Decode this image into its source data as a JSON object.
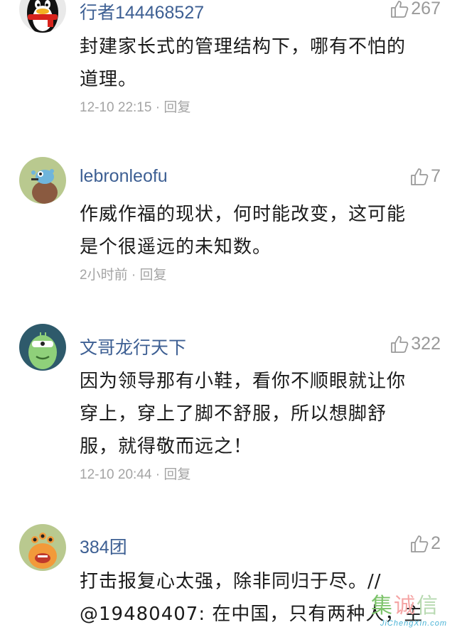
{
  "comments": [
    {
      "username": "行者144468527",
      "likes": "267",
      "lines": [
        "封建家长式的管理结构下，哪有不怕的",
        "道理。"
      ],
      "time": "12-10 22:15",
      "reply": "回复",
      "avatar_icon": "penguin-avatar-icon"
    },
    {
      "username": "lebronleofu",
      "likes": "7",
      "lines": [
        "作威作福的现状，何时能改变，这可能",
        "是个很遥远的未知数。"
      ],
      "time": "2小时前",
      "reply": "回复",
      "avatar_icon": "cartoon-creature-avatar-icon"
    },
    {
      "username": "文哥龙行天下",
      "likes": "322",
      "lines": [
        "因为领导那有小鞋，看你不顺眼就让你",
        "穿上，穿上了脚不舒服，所以想脚舒",
        "服，就得敬而远之！"
      ],
      "time": "12-10 20:44",
      "reply": "回复",
      "avatar_icon": "green-monster-avatar-icon"
    },
    {
      "username": "384团",
      "likes": "2",
      "lines": [
        "打击报复心太强，除非同归于尽。//",
        "@19480407: 在中国，只有两种人，主"
      ],
      "time": "",
      "reply": "",
      "avatar_icon": "orange-monster-avatar-icon"
    }
  ],
  "separator": " · ",
  "watermark": {
    "chars": [
      "集",
      "诚",
      "信"
    ],
    "url": "JiChengXin.com"
  },
  "colors": {
    "username": "#3d5f93",
    "text": "#1a1a1a",
    "meta": "#a4a4a4",
    "like": "#9a9a9a"
  }
}
